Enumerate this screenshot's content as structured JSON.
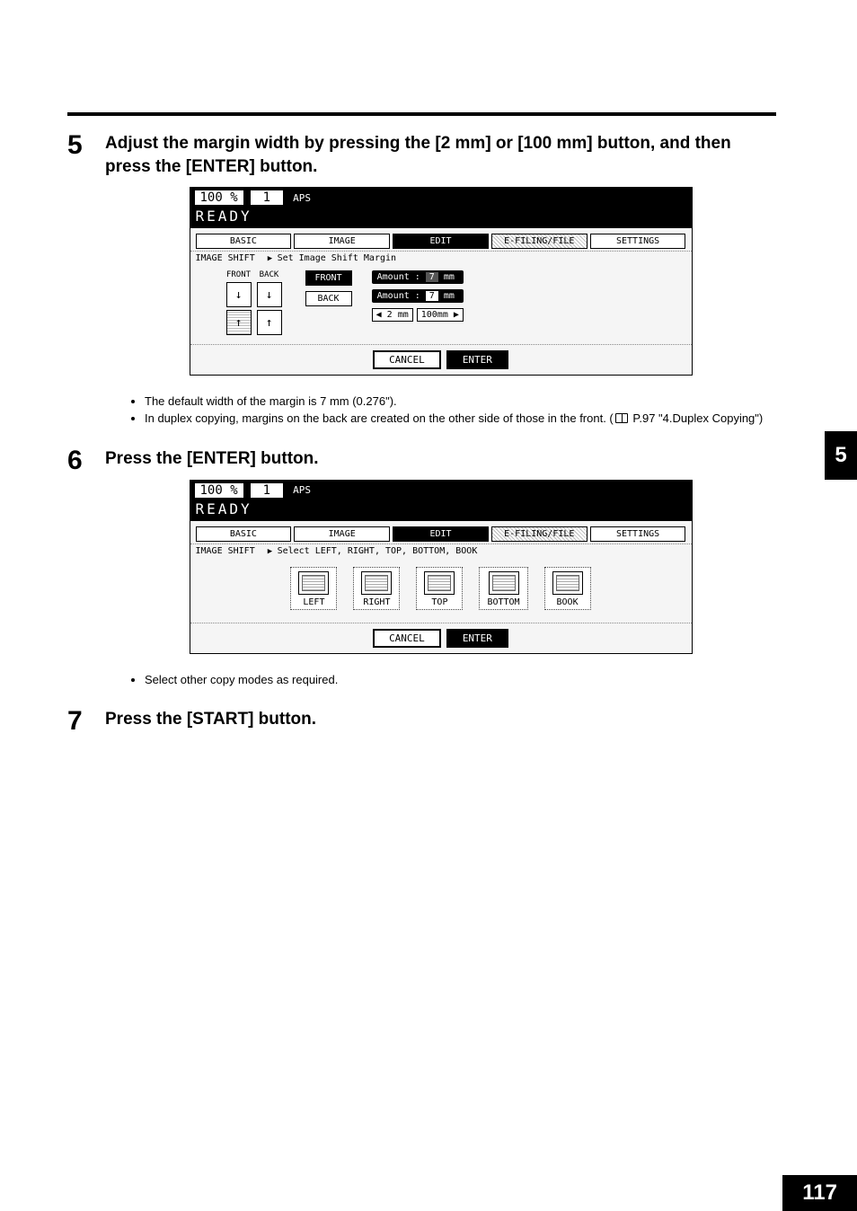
{
  "page_number": "117",
  "chapter_tab": "5",
  "steps": {
    "s5": {
      "num": "5",
      "heading": "Adjust the margin width by pressing the [2 mm] or [100 mm] button, and then press the [ENTER] button."
    },
    "s6": {
      "num": "6",
      "heading": "Press the [ENTER] button."
    },
    "s7": {
      "num": "7",
      "heading": "Press the [START] button."
    }
  },
  "notes": {
    "n1": "The default width of the margin is 7 mm (0.276\").",
    "n2a": "In duplex copying, margins on the back are created on the other side of those in the front. (",
    "n2b": " P.97 \"4.Duplex Copying\")",
    "n3": "Select other copy modes as required."
  },
  "screen": {
    "zoom": "100 %",
    "qty": "1",
    "aps": "APS",
    "ready": "READY",
    "tabs": {
      "basic": "BASIC",
      "image": "IMAGE",
      "edit": "EDIT",
      "efiling": "E-FILING/FILE",
      "settings": "SETTINGS"
    },
    "mode": "IMAGE SHIFT",
    "promptA": "Set Image Shift Margin",
    "promptB": "Select LEFT, RIGHT, TOP, BOTTOM, BOOK",
    "diag": {
      "front": "FRONT",
      "back": "BACK"
    },
    "btns": {
      "front": "FRONT",
      "back": "BACK"
    },
    "amount_label": "Amount :",
    "amount_front": "7",
    "amount_front_unit": "mm",
    "amount_back": "7",
    "amount_back_unit": "mm",
    "dec": "◀ 2 mm",
    "inc": "100mm ▶",
    "opts": {
      "left": "LEFT",
      "right": "RIGHT",
      "top": "TOP",
      "bottom": "BOTTOM",
      "book": "BOOK"
    },
    "cancel": "CANCEL",
    "enter": "ENTER"
  }
}
